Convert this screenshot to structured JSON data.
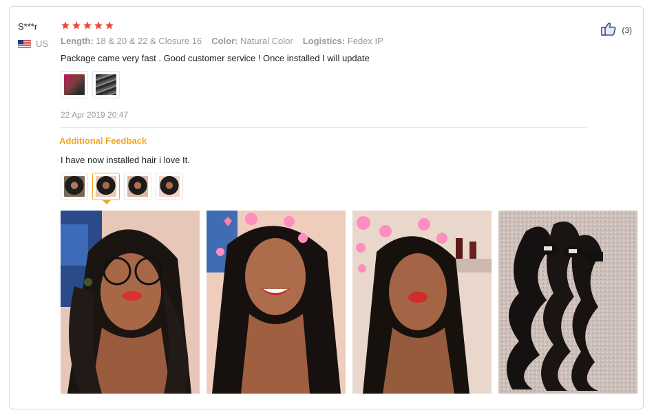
{
  "review": {
    "user_name": "S***r",
    "country": "US",
    "rating": 5,
    "meta": {
      "length_label": "Length:",
      "length_value": "18 & 20 & 22 & Closure 16",
      "color_label": "Color:",
      "color_value": "Natural Color",
      "logistics_label": "Logistics:",
      "logistics_value": "Fedex IP"
    },
    "text": "Package came very fast . Good customer service ! Once installed I will update",
    "date": "22 Apr 2019 20:47",
    "helpful_count": "(3)"
  },
  "additional": {
    "title": "Additional Feedback",
    "text": "I have now installed hair i love It.",
    "selected_thumb": 1
  },
  "colors": {
    "star": "#f44336",
    "accent": "#f5a623",
    "muted": "#999999"
  },
  "icons": {
    "helpful": "thumbs-up-icon",
    "flag": "us-flag-icon",
    "star": "star-icon"
  }
}
